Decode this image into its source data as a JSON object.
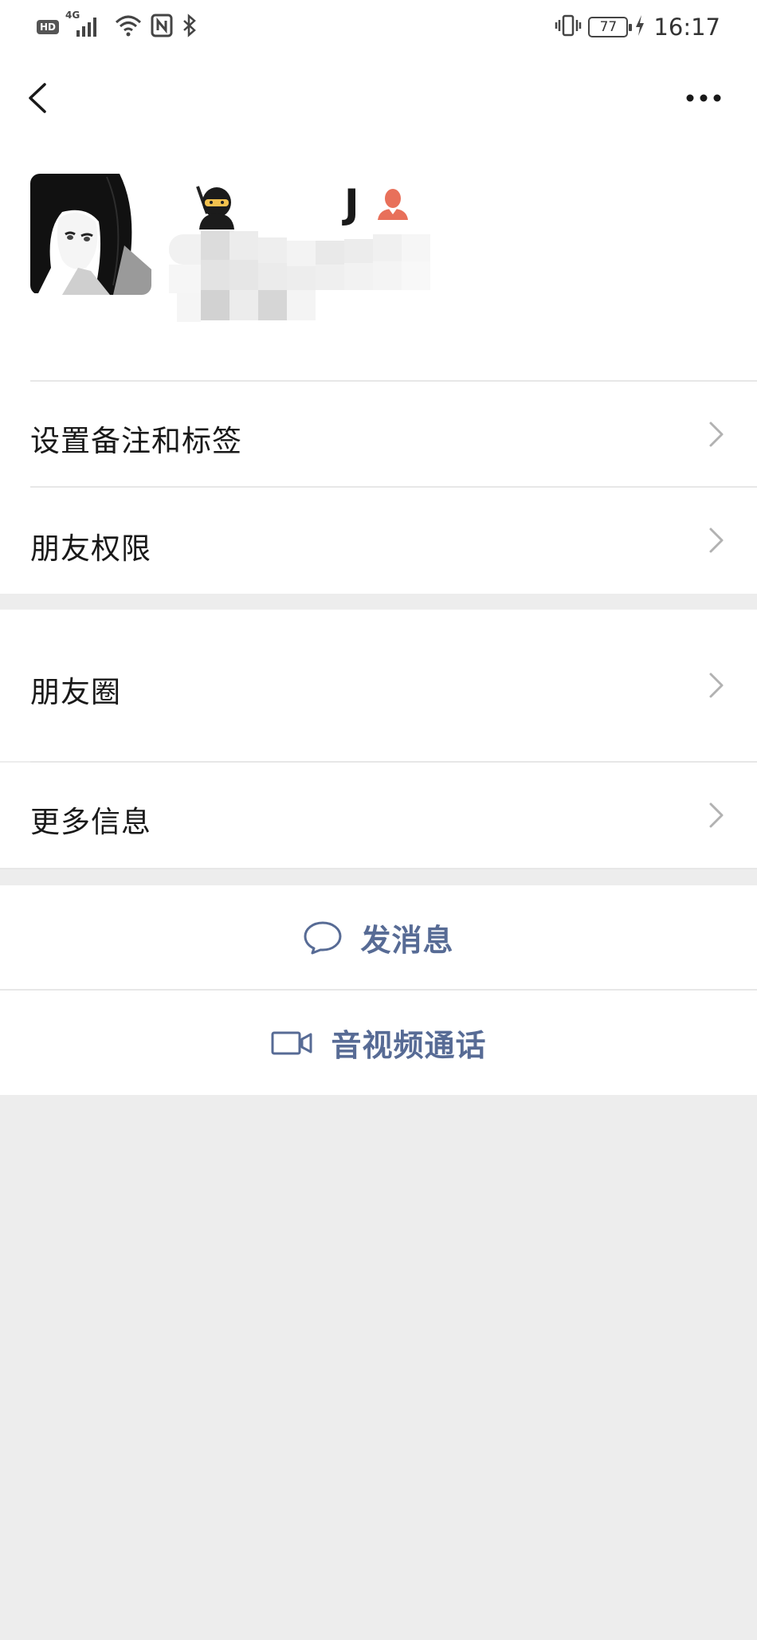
{
  "status_bar": {
    "left_icons": [
      "hd-icon",
      "4g-signal-icon",
      "wifi-icon",
      "nfc-icon",
      "bluetooth-icon"
    ],
    "hd": "HD",
    "network": "4G",
    "battery": "77",
    "time": "16:17"
  },
  "nav": {
    "back_icon": "chevron-left-icon",
    "more_icon": "more-dots-icon"
  },
  "profile": {
    "name_initial": "J",
    "name_emojis": [
      "ninja-emoji",
      "person-emoji"
    ]
  },
  "menu_group_1": [
    {
      "label": "设置备注和标签"
    },
    {
      "label": "朋友权限"
    }
  ],
  "menu_group_2": [
    {
      "label": "朋友圈"
    },
    {
      "label": "更多信息"
    }
  ],
  "actions": {
    "send_message": "发消息",
    "video_call": "音视频通话"
  },
  "colors": {
    "background": "#ededed",
    "card": "#ffffff",
    "link_blue": "#576b95",
    "chevron": "#b2b2b2",
    "divider": "#e7e7e7"
  }
}
